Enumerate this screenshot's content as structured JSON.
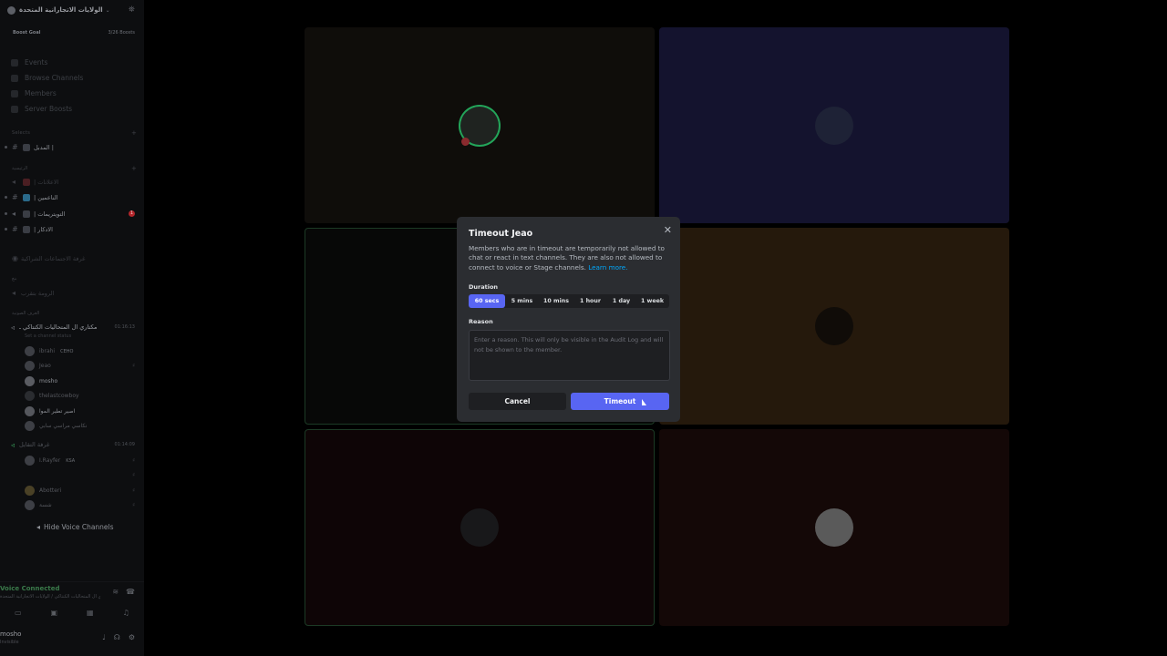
{
  "sidebar": {
    "server_name": "الولايات الاتجارانية المتحدة",
    "boost_goal": "Boost Goal",
    "boost_count": "3/26 Boosts",
    "nav": [
      "Events",
      "Browse Channels",
      "Members",
      "Server Boosts"
    ],
    "cat1": "Selects",
    "channels1": [
      {
        "name": "المدبل |"
      }
    ],
    "cat2": "الرئيسية",
    "channels2": [
      {
        "name": "| الاعلانات"
      },
      {
        "name": "| الناعمين"
      },
      {
        "name": "| التويتريمات",
        "badge": "1"
      },
      {
        "name": "| الادكار"
      }
    ],
    "extra1": "غرفة الاجتماعات الشراكية",
    "cat3": "بنغ",
    "extra2": "الرومة بتقرب",
    "cat4": "الغرف الصوتية",
    "voice1": {
      "name": "مكتاري ال المتحاليات الكنتاكي ـ",
      "time": "01:16:13",
      "sub": "Set a channel status"
    },
    "voice1_users": [
      {
        "name": "ibrahi",
        "tag": "CEHO"
      },
      {
        "name": "Jeao",
        "tag": ""
      },
      {
        "name": "mosho",
        "tag": ""
      },
      {
        "name": "thelastcowboy",
        "tag": ""
      },
      {
        "name": "اصير تطير الموا",
        "tag": ""
      },
      {
        "name": "نكاسي مراسي سابي",
        "tag": ""
      }
    ],
    "voice2": {
      "name": "غرفة التقايل",
      "time": "01:14:09"
    },
    "voice2_users": [
      {
        "name": "I.Rayfer",
        "tag": "KSA"
      },
      {
        "name": "",
        "tag": ""
      },
      {
        "name": "Abotteri",
        "tag": ""
      },
      {
        "name": "شسة",
        "tag": ""
      }
    ],
    "hide_voice": "Hide Voice Channels",
    "voice_connected": "Voice Connected",
    "voice_location": "مكتاري ال المتحاليات الكنتاكي / الولايات الاتجارانية المتحدة",
    "user_name": "mosho",
    "user_status": "Invisible"
  },
  "modal": {
    "title": "Timeout Jeao",
    "description": "Members who are in timeout are temporarily not allowed to chat or react in text channels. They are also not allowed to connect to voice or Stage channels.",
    "learn_more": "Learn more.",
    "duration_label": "Duration",
    "durations": [
      "60 secs",
      "5 mins",
      "10 mins",
      "1 hour",
      "1 day",
      "1 week"
    ],
    "selected_duration": "60 secs",
    "reason_label": "Reason",
    "reason_placeholder": "Enter a reason. This will only be visible in the Audit Log and will not be shown to the member.",
    "reason_value": "",
    "cancel_label": "Cancel",
    "timeout_label": "Timeout"
  },
  "icons": {
    "close": "close-icon",
    "speaker": "speaker-icon",
    "hash": "hash-icon"
  },
  "colors": {
    "accent": "#5865f2",
    "modal_bg": "#2b2d31",
    "link": "#00a8fc"
  }
}
